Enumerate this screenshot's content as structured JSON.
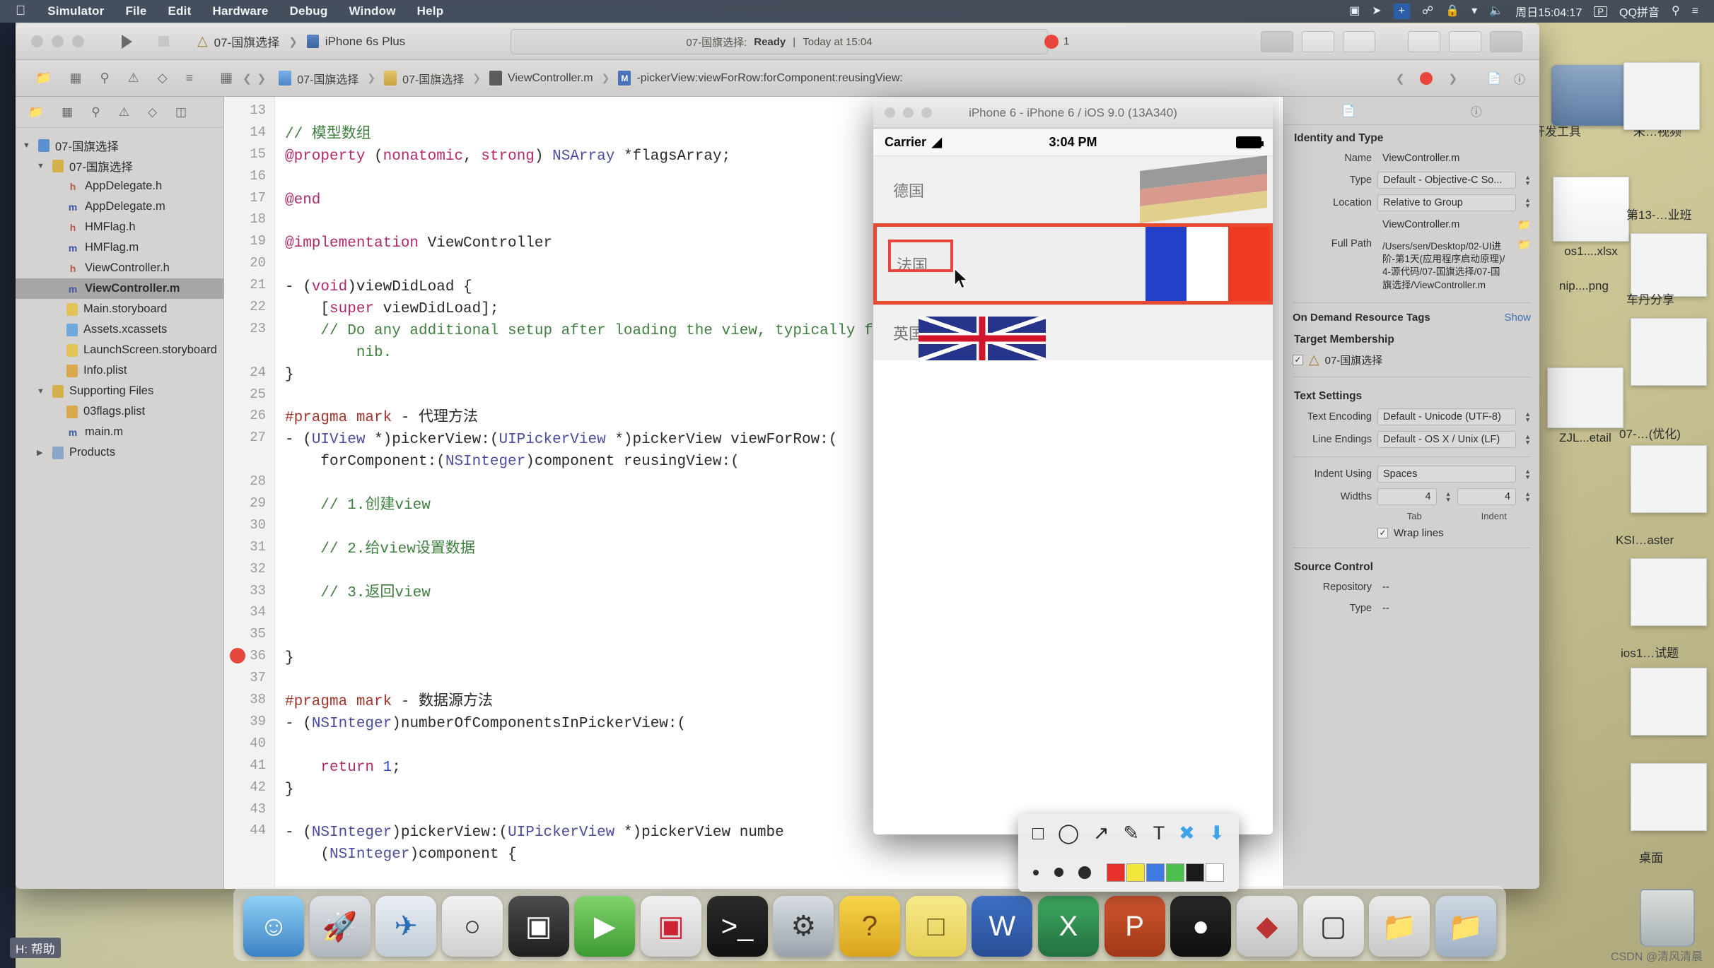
{
  "menubar": {
    "apple": "",
    "items": [
      "Simulator",
      "File",
      "Edit",
      "Hardware",
      "Debug",
      "Window",
      "Help"
    ],
    "right": {
      "screen_icon": "screen-record-icon",
      "location_icon": "location-icon",
      "plus_icon": "+",
      "bluetooth_icon": "bluetooth-icon",
      "lock_icon": "lock-icon",
      "wifi_icon": "wifi-icon",
      "volume_icon": "volume-icon",
      "clock": "周日15:04:17",
      "input_badge": "P",
      "input_method": "QQ拼音",
      "search_icon": "search-icon",
      "list_icon": "list-icon"
    }
  },
  "xcode": {
    "scheme": "07-国旗选择",
    "device": "iPhone 6s Plus",
    "status": {
      "target": "07-国旗选择:",
      "state": "Ready",
      "divider": "|",
      "time": "Today at 15:04"
    },
    "issue_count": "1",
    "breadcrumb": [
      "07-国旗选择",
      "07-国旗选择",
      "ViewController.m",
      "-pickerView:viewForRow:forComponent:reusingView:"
    ],
    "navigator": {
      "toolbar_icons": [
        "folder-icon",
        "source-control-icon",
        "search-icon",
        "warning-icon",
        "breakpoint-icon",
        "report-icon"
      ],
      "tree": [
        {
          "indent": 0,
          "twisty": "▼",
          "icon": "project",
          "label": "07-国旗选择",
          "selected": false
        },
        {
          "indent": 1,
          "twisty": "▼",
          "icon": "folder",
          "label": "07-国旗选择",
          "selected": false
        },
        {
          "indent": 2,
          "twisty": "",
          "icon": "h",
          "label": "AppDelegate.h",
          "selected": false
        },
        {
          "indent": 2,
          "twisty": "",
          "icon": "m",
          "label": "AppDelegate.m",
          "selected": false
        },
        {
          "indent": 2,
          "twisty": "",
          "icon": "h",
          "label": "HMFlag.h",
          "selected": false
        },
        {
          "indent": 2,
          "twisty": "",
          "icon": "m",
          "label": "HMFlag.m",
          "selected": false
        },
        {
          "indent": 2,
          "twisty": "",
          "icon": "h",
          "label": "ViewController.h",
          "selected": false
        },
        {
          "indent": 2,
          "twisty": "",
          "icon": "m",
          "label": "ViewController.m",
          "selected": true
        },
        {
          "indent": 2,
          "twisty": "",
          "icon": "storyboard",
          "label": "Main.storyboard",
          "selected": false
        },
        {
          "indent": 2,
          "twisty": "",
          "icon": "assets",
          "label": "Assets.xcassets",
          "selected": false
        },
        {
          "indent": 2,
          "twisty": "",
          "icon": "storyboard",
          "label": "LaunchScreen.storyboard",
          "selected": false
        },
        {
          "indent": 2,
          "twisty": "",
          "icon": "plist",
          "label": "Info.plist",
          "selected": false
        },
        {
          "indent": 1,
          "twisty": "▼",
          "icon": "folder",
          "label": "Supporting Files",
          "selected": false
        },
        {
          "indent": 2,
          "twisty": "",
          "icon": "plist",
          "label": "03flags.plist",
          "selected": false
        },
        {
          "indent": 2,
          "twisty": "",
          "icon": "m",
          "label": "main.m",
          "selected": false
        },
        {
          "indent": 1,
          "twisty": "▶",
          "icon": "folder-blue",
          "label": "Products",
          "selected": false
        }
      ]
    },
    "editor": {
      "first_line_number": 13,
      "error_line": 36,
      "lines": [
        {
          "n": 13,
          "segs": []
        },
        {
          "n": 14,
          "segs": [
            {
              "t": "// 模型数组",
              "c": "cm"
            }
          ]
        },
        {
          "n": 15,
          "segs": [
            {
              "t": "@property",
              "c": "kw"
            },
            {
              "t": " (",
              "c": "nm"
            },
            {
              "t": "nonatomic",
              "c": "kw"
            },
            {
              "t": ", ",
              "c": "nm"
            },
            {
              "t": "strong",
              "c": "kw"
            },
            {
              "t": ") ",
              "c": "nm"
            },
            {
              "t": "NSArray",
              "c": "ty"
            },
            {
              "t": " *flagsArray;",
              "c": "nm"
            }
          ]
        },
        {
          "n": 16,
          "segs": []
        },
        {
          "n": 17,
          "segs": [
            {
              "t": "@end",
              "c": "kw"
            }
          ]
        },
        {
          "n": 18,
          "segs": []
        },
        {
          "n": 19,
          "segs": [
            {
              "t": "@implementation",
              "c": "kw"
            },
            {
              "t": " ViewController",
              "c": "nm"
            }
          ]
        },
        {
          "n": 20,
          "segs": []
        },
        {
          "n": 21,
          "segs": [
            {
              "t": "- (",
              "c": "nm"
            },
            {
              "t": "void",
              "c": "kw"
            },
            {
              "t": ")viewDidLoad {",
              "c": "nm"
            }
          ]
        },
        {
          "n": 22,
          "segs": [
            {
              "t": "    [",
              "c": "nm"
            },
            {
              "t": "super",
              "c": "kw"
            },
            {
              "t": " viewDidLoad];",
              "c": "nm"
            }
          ]
        },
        {
          "n": 23,
          "segs": [
            {
              "t": "    // Do any additional setup after loading the view, typically from a",
              "c": "cm"
            }
          ]
        },
        {
          "n": 0,
          "segs": [
            {
              "t": "        nib.",
              "c": "cm"
            }
          ]
        },
        {
          "n": 24,
          "segs": [
            {
              "t": "}",
              "c": "nm"
            }
          ]
        },
        {
          "n": 25,
          "segs": []
        },
        {
          "n": 26,
          "segs": [
            {
              "t": "#pragma mark",
              "c": "pp"
            },
            {
              "t": " - 代理方法",
              "c": "nm"
            }
          ]
        },
        {
          "n": 27,
          "segs": [
            {
              "t": "- (",
              "c": "nm"
            },
            {
              "t": "UIView",
              "c": "ty"
            },
            {
              "t": " *)pickerView:(",
              "c": "nm"
            },
            {
              "t": "UIPickerView",
              "c": "ty"
            },
            {
              "t": " *)pickerView viewForRow:(",
              "c": "nm"
            }
          ]
        },
        {
          "n": 0,
          "segs": [
            {
              "t": "    forComponent:(",
              "c": "nm"
            },
            {
              "t": "NSInteger",
              "c": "ty"
            },
            {
              "t": ")component reusingView:(",
              "c": "nm"
            }
          ]
        },
        {
          "n": 28,
          "segs": []
        },
        {
          "n": 29,
          "segs": [
            {
              "t": "    // 1.创建view",
              "c": "cm"
            }
          ]
        },
        {
          "n": 30,
          "segs": []
        },
        {
          "n": 31,
          "segs": [
            {
              "t": "    // 2.给view设置数据",
              "c": "cm"
            }
          ]
        },
        {
          "n": 32,
          "segs": []
        },
        {
          "n": 33,
          "segs": [
            {
              "t": "    // 3.返回view",
              "c": "cm"
            }
          ]
        },
        {
          "n": 34,
          "segs": []
        },
        {
          "n": 35,
          "segs": []
        },
        {
          "n": 36,
          "segs": [
            {
              "t": "}",
              "c": "nm"
            }
          ]
        },
        {
          "n": 37,
          "segs": []
        },
        {
          "n": 38,
          "segs": [
            {
              "t": "#pragma mark",
              "c": "pp"
            },
            {
              "t": " - 数据源方法",
              "c": "nm"
            }
          ]
        },
        {
          "n": 39,
          "segs": [
            {
              "t": "- (",
              "c": "nm"
            },
            {
              "t": "NSInteger",
              "c": "ty"
            },
            {
              "t": ")numberOfComponentsInPickerView:(",
              "c": "nm"
            }
          ]
        },
        {
          "n": 40,
          "segs": []
        },
        {
          "n": 41,
          "segs": [
            {
              "t": "    return ",
              "c": "kw"
            },
            {
              "t": "1",
              "c": "num"
            },
            {
              "t": ";",
              "c": "nm"
            }
          ]
        },
        {
          "n": 42,
          "segs": [
            {
              "t": "}",
              "c": "nm"
            }
          ]
        },
        {
          "n": 43,
          "segs": []
        },
        {
          "n": 44,
          "segs": [
            {
              "t": "- (",
              "c": "nm"
            },
            {
              "t": "NSInteger",
              "c": "ty"
            },
            {
              "t": ")pickerView:(",
              "c": "nm"
            },
            {
              "t": "UIPickerView",
              "c": "ty"
            },
            {
              "t": " *)pickerView numbe",
              "c": "nm"
            }
          ]
        },
        {
          "n": 0,
          "segs": [
            {
              "t": "    (",
              "c": "nm"
            },
            {
              "t": "NSInteger",
              "c": "ty"
            },
            {
              "t": ")component {",
              "c": "nm"
            }
          ]
        }
      ]
    },
    "inspector": {
      "section_identity": "Identity and Type",
      "name_label": "Name",
      "name_value": "ViewController.m",
      "type_label": "Type",
      "type_value": "Default - Objective-C So...",
      "location_label": "Location",
      "location_value": "Relative to Group",
      "location_file": "ViewController.m",
      "fullpath_label": "Full Path",
      "fullpath_value": "/Users/sen/Desktop/02-UI进阶-第1天(应用程序启动原理)/4-源代码/07-国旗选择/07-国旗选择/ViewController.m",
      "ondemand_label": "On Demand Resource Tags",
      "ondemand_show": "Show",
      "target_membership": "Target Membership",
      "target_item": "07-国旗选择",
      "text_settings": "Text Settings",
      "encoding_label": "Text Encoding",
      "encoding_value": "Default - Unicode (UTF-8)",
      "lineendings_label": "Line Endings",
      "lineendings_value": "Default - OS X / Unix (LF)",
      "indent_label": "Indent Using",
      "indent_value": "Spaces",
      "widths_label": "Widths",
      "tab_value": "4",
      "indent_value_num": "4",
      "tab_sub": "Tab",
      "indent_sub": "Indent",
      "wrap_label": "Wrap lines",
      "wrap_checked": "✓",
      "source_control": "Source Control",
      "repository_label": "Repository",
      "repository_value": "--",
      "type2_label": "Type",
      "type2_value": "--"
    }
  },
  "simulator": {
    "window_title": "iPhone 6 - iPhone 6 / iOS 9.0 (13A340)",
    "carrier": "Carrier",
    "time": "3:04 PM",
    "picker_rows": [
      {
        "label": "德国",
        "flag": "de",
        "selected": false
      },
      {
        "label": "法国",
        "flag": "fr",
        "selected": true
      },
      {
        "label": "英国",
        "flag": "uk",
        "selected": false
      }
    ]
  },
  "annotation_toolbar": {
    "tools": [
      "rect-icon",
      "ellipse-icon",
      "arrow-icon",
      "highlighter-icon",
      "text-icon",
      "close-icon",
      "download-icon"
    ],
    "sizes": [
      "small-dot",
      "medium-dot",
      "large-dot"
    ],
    "colors": [
      "#e8312a",
      "#f2e53c",
      "#3f7ae0",
      "#4cc04c",
      "#1a1a1a",
      "#ffffff"
    ]
  },
  "desktop": {
    "right_labels": [
      "开发工具",
      "未…视频",
      "第13-…业班",
      "车丹分享",
      "07-…(优化)",
      "KSI…aster",
      "ios1…试题",
      "桌面"
    ],
    "icon_labels": [
      "os1....xlsx",
      "nip....png",
      "ZJL...etail"
    ]
  },
  "dock": {
    "items": [
      "finder",
      "launchpad",
      "safari",
      "mail",
      "photos",
      "facetime",
      "calendar",
      "notes",
      "reminders",
      "terminal",
      "preferences",
      "help",
      "stickies",
      "word",
      "excel",
      "powerpoint",
      "appstore",
      "xcode",
      "simulator",
      "music",
      "folder1",
      "folder2"
    ]
  },
  "overlay": {
    "helper_text": "H: 帮助",
    "watermark": "CSDN @清风清晨"
  }
}
